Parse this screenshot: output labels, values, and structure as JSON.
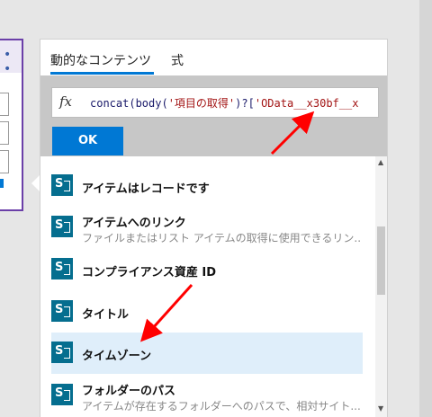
{
  "left_card": {
    "header_text": "• •"
  },
  "tabs": [
    {
      "label": "動的なコンテンツ",
      "active": true
    },
    {
      "label": "式",
      "active": false
    }
  ],
  "expression": {
    "fx_label": "fx",
    "text_prefix": "concat(body(",
    "text_str1": "'項目の取得'",
    "text_mid": ")?[",
    "text_str2": "'OData__x30bf__x",
    "ok_label": "OK"
  },
  "items": [
    {
      "title": "アイテムはレコードです",
      "subtitle": ""
    },
    {
      "title": "アイテムへのリンク",
      "subtitle": "ファイルまたはリスト アイテムの取得に使用できるリン..."
    },
    {
      "title": "コンプライアンス資産 ID",
      "subtitle": ""
    },
    {
      "title": "タイトル",
      "subtitle": ""
    },
    {
      "title": "タイムゾーン",
      "subtitle": ""
    },
    {
      "title": "フォルダーのパス",
      "subtitle": "アイテムが存在するフォルダーへのパスで、相対サイト..."
    }
  ],
  "colors": {
    "accent": "#0078d4",
    "arrow": "#ff0000",
    "selected_row": "#dfeefa",
    "sharepoint_icon": "#056e8f"
  },
  "icons": {
    "item_icon": "sharepoint-icon",
    "scroll_up": "scroll-up-icon",
    "scroll_down": "scroll-down-icon"
  }
}
